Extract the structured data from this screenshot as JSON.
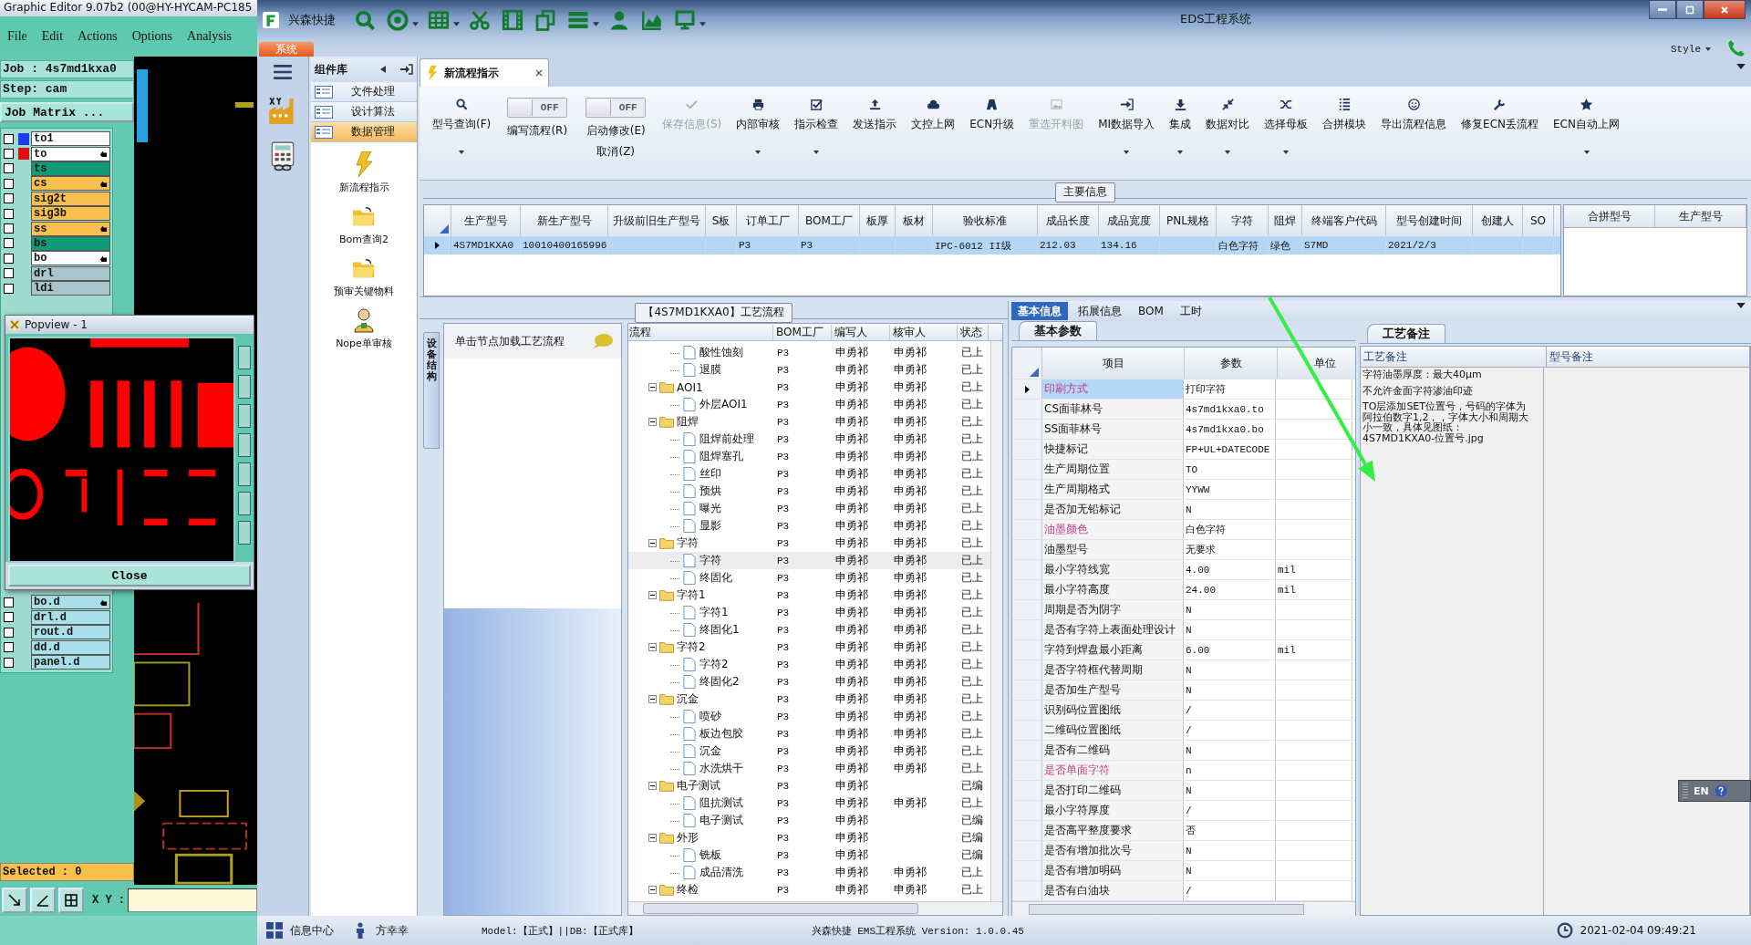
{
  "graphic_editor": {
    "title": "Graphic Editor 9.07b2 (00@HY-HYCAM-PC185",
    "menu": [
      "File",
      "Edit",
      "Actions",
      "Options",
      "Analysis"
    ],
    "job": "Job : 4s7md1kxa0",
    "step": "Step: cam",
    "job_matrix_button": "Job Matrix ...",
    "layers": [
      {
        "name": "to1",
        "color": "#ffffff",
        "swatch": {
          "color": "#1c3cf0"
        },
        "marked": false,
        "checked": false
      },
      {
        "name": "to",
        "color": "#ffffff",
        "swatch": {
          "color": "#e01010"
        },
        "marked": true,
        "checked": false
      },
      {
        "name": "ts",
        "color": "#109a78",
        "marked": false,
        "checked": false
      },
      {
        "name": "cs",
        "color": "#f7c04e",
        "marked": true,
        "checked": false
      },
      {
        "name": "sig2t",
        "color": "#f7c04e",
        "marked": false,
        "checked": false
      },
      {
        "name": "sig3b",
        "color": "#f7c04e",
        "marked": false,
        "checked": false
      },
      {
        "name": "ss",
        "color": "#f7c04e",
        "marked": true,
        "checked": false
      },
      {
        "name": "bs",
        "color": "#109a78",
        "marked": false,
        "checked": false
      },
      {
        "name": "bo",
        "color": "#ffffff",
        "marked": true,
        "checked": false
      },
      {
        "name": "drl",
        "color": "#a8c4cc",
        "marked": false,
        "checked": false
      },
      {
        "name": "ldi",
        "color": "#a8c4cc",
        "marked": false,
        "checked": false
      }
    ],
    "popview": {
      "title": "Popview - 1",
      "close_button": "Close"
    },
    "lower_layers": [
      {
        "name": "bo.d",
        "color": "#a8dfe8",
        "marked": true,
        "checked": false
      },
      {
        "name": "drl.d",
        "color": "#a8dfe8",
        "marked": false,
        "checked": false
      },
      {
        "name": "rout.d",
        "color": "#a8dfe8",
        "marked": false,
        "checked": false
      },
      {
        "name": "dd.d",
        "color": "#a8dfe8",
        "marked": false,
        "checked": false
      },
      {
        "name": "panel.d",
        "color": "#a8dfe8",
        "marked": false,
        "checked": false
      }
    ],
    "selected": "Selected : 0",
    "xy_label": "X Y :"
  },
  "eds": {
    "quick_title": "兴森快捷",
    "title": "EDS工程系统",
    "system_tab": "系统",
    "style_menu": "Style",
    "side_panel": {
      "title": "组件库",
      "groups": [
        {
          "label": "文件处理",
          "selected": false
        },
        {
          "label": "设计算法",
          "selected": false
        },
        {
          "label": "数据管理",
          "selected": true
        }
      ],
      "tools": [
        {
          "label": "新流程指示",
          "kind": "bolt"
        },
        {
          "label": "Bom查询2",
          "kind": "folder"
        },
        {
          "label": "预审关键物料",
          "kind": "folder"
        },
        {
          "label": "Nope单审核",
          "kind": "person"
        }
      ]
    },
    "document_tab": "新流程指示",
    "ribbon": [
      {
        "kind": "button",
        "label": "型号查询(F)",
        "dropdown": true,
        "disabled": false
      },
      {
        "kind": "toggle",
        "toggle_text": "OFF",
        "on": false,
        "label": "编写流程(R)",
        "disabled": false
      },
      {
        "kind": "toggle",
        "toggle_text": "OFF",
        "on": false,
        "label": "启动修改(E)",
        "label_2": "取消(Z)",
        "disabled": false
      },
      {
        "kind": "button",
        "label": "保存信息(S)",
        "dropdown": false,
        "disabled": true
      },
      {
        "kind": "button",
        "label": "内部审核",
        "dropdown": true,
        "disabled": false
      },
      {
        "kind": "button",
        "label": "指示检查",
        "dropdown": true,
        "disabled": false
      },
      {
        "kind": "button",
        "label": "发送指示",
        "dropdown": false,
        "disabled": false
      },
      {
        "kind": "button",
        "label": "文控上网",
        "dropdown": false,
        "disabled": false
      },
      {
        "kind": "button",
        "label": "ECN升级",
        "dropdown": false,
        "disabled": false
      },
      {
        "kind": "button",
        "label": "重选开料图",
        "dropdown": false,
        "disabled": true
      },
      {
        "kind": "button",
        "label": "MI数据导入",
        "dropdown": true,
        "disabled": false
      },
      {
        "kind": "button",
        "label": "集成",
        "dropdown": true,
        "disabled": false
      },
      {
        "kind": "button",
        "label": "数据对比",
        "dropdown": true,
        "disabled": false
      },
      {
        "kind": "button",
        "label": "选择母板",
        "dropdown": true,
        "disabled": false
      },
      {
        "kind": "button",
        "label": "合拼模块",
        "dropdown": false,
        "disabled": false
      },
      {
        "kind": "button",
        "label": "导出流程信息",
        "dropdown": false,
        "disabled": false
      },
      {
        "kind": "button",
        "label": "修复ECN丢流程",
        "dropdown": false,
        "disabled": false
      },
      {
        "kind": "button",
        "label": "ECN自动上网",
        "dropdown": true,
        "disabled": false
      }
    ],
    "main_info": {
      "legend": "主要信息",
      "columns": [
        "生产型号",
        "新生产型号",
        "升级前旧生产型号",
        "S板",
        "订单工厂",
        "BOM工厂",
        "板厚",
        "板材",
        "验收标准",
        "成品长度",
        "成品宽度",
        "PNL规格",
        "字符",
        "阻焊",
        "终端客户代码",
        "型号创建时间",
        "创建人",
        "SO"
      ],
      "rows": [
        {
          "selected": true,
          "cells": [
            "4S7MD1KXA0",
            "10010400165996",
            null,
            null,
            "P3",
            "P3",
            null,
            null,
            "IPC-6012 II级",
            "212.03",
            "134.16",
            null,
            "白色字符",
            "绿色",
            "S7MD",
            "2021/2/3",
            null,
            null
          ]
        }
      ],
      "side_columns": [
        "合拼型号",
        "生产型号"
      ]
    },
    "flow": {
      "title": "【4S7MD1KXA0】工艺流程",
      "side_tab": "设备结构",
      "hint": "单击节点加载工艺流程",
      "columns": [
        "流程",
        "BOM工厂",
        "编写人",
        "核审人",
        "状态"
      ],
      "tree": [
        {
          "children": [
            {
              "kind": "doc",
              "name": "酸性蚀刻",
              "bom": "P3",
              "writer": "申勇祁",
              "reviewer": "申勇祁",
              "status": "已上",
              "selected": false
            },
            {
              "kind": "doc",
              "name": "退膜",
              "bom": "P3",
              "writer": "申勇祁",
              "reviewer": "申勇祁",
              "status": "已上",
              "selected": false
            }
          ]
        },
        {
          "kind": "folder",
          "name": "AOI1",
          "bom": "P3",
          "writer": "申勇祁",
          "reviewer": "申勇祁",
          "status": "已上",
          "selected": false,
          "expanded": true,
          "children": [
            {
              "kind": "doc",
              "name": "外层AOI1",
              "bom": "P3",
              "writer": "申勇祁",
              "reviewer": "申勇祁",
              "status": "已上",
              "selected": false
            }
          ]
        },
        {
          "kind": "folder",
          "name": "阻焊",
          "bom": "P3",
          "writer": "申勇祁",
          "reviewer": "申勇祁",
          "status": "已上",
          "selected": false,
          "expanded": true,
          "children": [
            {
              "kind": "doc",
              "name": "阻焊前处理",
              "bom": "P3",
              "writer": "申勇祁",
              "reviewer": "申勇祁",
              "status": "已上",
              "selected": false
            },
            {
              "kind": "doc",
              "name": "阻焊塞孔",
              "bom": "P3",
              "writer": "申勇祁",
              "reviewer": "申勇祁",
              "status": "已上",
              "selected": false
            },
            {
              "kind": "doc",
              "name": "丝印",
              "bom": "P3",
              "writer": "申勇祁",
              "reviewer": "申勇祁",
              "status": "已上",
              "selected": false
            },
            {
              "kind": "doc",
              "name": "预烘",
              "bom": "P3",
              "writer": "申勇祁",
              "reviewer": "申勇祁",
              "status": "已上",
              "selected": false
            },
            {
              "kind": "doc",
              "name": "曝光",
              "bom": "P3",
              "writer": "申勇祁",
              "reviewer": "申勇祁",
              "status": "已上",
              "selected": false
            },
            {
              "kind": "doc",
              "name": "显影",
              "bom": "P3",
              "writer": "申勇祁",
              "reviewer": "申勇祁",
              "status": "已上",
              "selected": false
            }
          ]
        },
        {
          "kind": "folder",
          "name": "字符",
          "bom": "P3",
          "writer": "申勇祁",
          "reviewer": "申勇祁",
          "status": "已上",
          "selected": false,
          "expanded": true,
          "children": [
            {
              "kind": "doc",
              "name": "字符",
              "bom": "P3",
              "writer": "申勇祁",
              "reviewer": "申勇祁",
              "status": "已上",
              "selected": true
            },
            {
              "kind": "doc",
              "name": "终固化",
              "bom": "P3",
              "writer": "申勇祁",
              "reviewer": "申勇祁",
              "status": "已上",
              "selected": false
            }
          ]
        },
        {
          "kind": "folder",
          "name": "字符1",
          "bom": "P3",
          "writer": "申勇祁",
          "reviewer": "申勇祁",
          "status": "已上",
          "selected": false,
          "expanded": true,
          "children": [
            {
              "kind": "doc",
              "name": "字符1",
              "bom": "P3",
              "writer": "申勇祁",
              "reviewer": "申勇祁",
              "status": "已上",
              "selected": false
            },
            {
              "kind": "doc",
              "name": "终固化1",
              "bom": "P3",
              "writer": "申勇祁",
              "reviewer": "申勇祁",
              "status": "已上",
              "selected": false
            }
          ]
        },
        {
          "kind": "folder",
          "name": "字符2",
          "bom": "P3",
          "writer": "申勇祁",
          "reviewer": "申勇祁",
          "status": "已上",
          "selected": false,
          "expanded": true,
          "children": [
            {
              "kind": "doc",
              "name": "字符2",
              "bom": "P3",
              "writer": "申勇祁",
              "reviewer": "申勇祁",
              "status": "已上",
              "selected": false
            },
            {
              "kind": "doc",
              "name": "终固化2",
              "bom": "P3",
              "writer": "申勇祁",
              "reviewer": "申勇祁",
              "status": "已上",
              "selected": false
            }
          ]
        },
        {
          "kind": "folder",
          "name": "沉金",
          "bom": "P3",
          "writer": "申勇祁",
          "reviewer": "申勇祁",
          "status": "已上",
          "selected": false,
          "expanded": true,
          "children": [
            {
              "kind": "doc",
              "name": "喷砂",
              "bom": "P3",
              "writer": "申勇祁",
              "reviewer": "申勇祁",
              "status": "已上",
              "selected": false
            },
            {
              "kind": "doc",
              "name": "板边包胶",
              "bom": "P3",
              "writer": "申勇祁",
              "reviewer": "申勇祁",
              "status": "已上",
              "selected": false
            },
            {
              "kind": "doc",
              "name": "沉金",
              "bom": "P3",
              "writer": "申勇祁",
              "reviewer": "申勇祁",
              "status": "已上",
              "selected": false
            },
            {
              "kind": "doc",
              "name": "水洗烘干",
              "bom": "P3",
              "writer": "申勇祁",
              "reviewer": "申勇祁",
              "status": "已上",
              "selected": false
            }
          ]
        },
        {
          "kind": "folder",
          "name": "电子测试",
          "bom": "P3",
          "writer": "申勇祁",
          "status": "已编",
          "selected": false,
          "expanded": true,
          "children": [
            {
              "kind": "doc",
              "name": "阻抗测试",
              "bom": "P3",
              "writer": "申勇祁",
              "reviewer": "申勇祁",
              "status": "已上",
              "selected": false
            },
            {
              "kind": "doc",
              "name": "电子测试",
              "bom": "P3",
              "writer": "申勇祁",
              "status": "已编",
              "selected": false
            }
          ]
        },
        {
          "kind": "folder",
          "name": "外形",
          "bom": "P3",
          "writer": "申勇祁",
          "status": "已编",
          "selected": false,
          "expanded": true,
          "children": [
            {
              "kind": "doc",
              "name": "铣板",
              "bom": "P3",
              "writer": "申勇祁",
              "status": "已编",
              "selected": false
            },
            {
              "kind": "doc",
              "name": "成品清洗",
              "bom": "P3",
              "writer": "申勇祁",
              "reviewer": "申勇祁",
              "status": "已上",
              "selected": false
            }
          ]
        },
        {
          "kind": "folder",
          "name": "终检",
          "bom": "P3",
          "writer": "申勇祁",
          "reviewer": "申勇祁",
          "status": "已上",
          "selected": false,
          "expanded": true
        }
      ]
    },
    "detail_tabs": [
      {
        "label": "基本信息",
        "selected": true
      },
      {
        "label": "拓展信息",
        "selected": false
      },
      {
        "label": "BOM",
        "selected": false
      },
      {
        "label": "工时",
        "selected": false
      }
    ],
    "params": {
      "tab": "基本参数",
      "columns": [
        "项目",
        "参数",
        "单位"
      ],
      "rows": [
        {
          "item": "印刷方式",
          "value": "打印字符",
          "flagged": true,
          "selected": true
        },
        {
          "item": "CS面菲林号",
          "value": "4s7md1kxa0.to",
          "flagged": false,
          "selected": false
        },
        {
          "item": "SS面菲林号",
          "value": "4s7md1kxa0.bo",
          "flagged": false,
          "selected": false
        },
        {
          "item": "快捷标记",
          "value": "FP+UL+DATECODE",
          "flagged": false,
          "selected": false
        },
        {
          "item": "生产周期位置",
          "value": "TO",
          "flagged": false,
          "selected": false
        },
        {
          "item": "生产周期格式",
          "value": "YYWW",
          "flagged": false,
          "selected": false
        },
        {
          "item": "是否加无铅标记",
          "value": "N",
          "flagged": false,
          "selected": false
        },
        {
          "item": "油墨颜色",
          "value": "白色字符",
          "flagged": true,
          "selected": false
        },
        {
          "item": "油墨型号",
          "value": "无要求",
          "flagged": false,
          "selected": false
        },
        {
          "item": "最小字符线宽",
          "value": "4.00",
          "unit": "mil",
          "flagged": false,
          "selected": false
        },
        {
          "item": "最小字符高度",
          "value": "24.00",
          "unit": "mil",
          "flagged": false,
          "selected": false
        },
        {
          "item": "周期是否为阴字",
          "value": "N",
          "flagged": false,
          "selected": false
        },
        {
          "item": "是否有字符上表面处理设计",
          "value": "N",
          "flagged": false,
          "selected": false
        },
        {
          "item": "字符到焊盘最小距离",
          "value": "6.00",
          "unit": "mil",
          "flagged": false,
          "selected": false
        },
        {
          "item": "是否字符框代替周期",
          "value": "N",
          "flagged": false,
          "selected": false
        },
        {
          "item": "是否加生产型号",
          "value": "N",
          "flagged": false,
          "selected": false
        },
        {
          "item": "识别码位置图纸",
          "value": "/",
          "flagged": false,
          "selected": false
        },
        {
          "item": "二维码位置图纸",
          "value": "/",
          "flagged": false,
          "selected": false
        },
        {
          "item": "是否有二维码",
          "value": "N",
          "flagged": false,
          "selected": false
        },
        {
          "item": "是否单面字符",
          "value": "n",
          "flagged": true,
          "selected": false
        },
        {
          "item": "是否打印二维码",
          "value": "N",
          "flagged": false,
          "selected": false
        },
        {
          "item": "最小字符厚度",
          "value": "/",
          "flagged": false,
          "selected": false
        },
        {
          "item": "是否高平整度要求",
          "value": "否",
          "flagged": false,
          "selected": false
        },
        {
          "item": "是否有增加批次号",
          "value": "N",
          "flagged": false,
          "selected": false
        },
        {
          "item": "是否有增加明码",
          "value": "N",
          "flagged": false,
          "selected": false
        },
        {
          "item": "是否有白油块",
          "value": "/",
          "flagged": false,
          "selected": false
        }
      ]
    },
    "notes": {
      "tab": "工艺备注",
      "columns": [
        "工艺备注",
        "型号备注"
      ],
      "process_notes": [
        "字符油墨厚度：最大40μm",
        "不允许金面字符渗油印迹",
        "TO层添加SET位置号，号码的字体为阿拉伯数字1,2，，字体大小和周期大小一致，具体见图纸：4S7MD1KXA0-位置号.jpg"
      ]
    },
    "ime": "EN",
    "status_bar": {
      "info_center": "信息中心",
      "user": "方幸幸",
      "model": "Model:【正式】||DB:【正式库】",
      "version": "兴森快捷 EMS工程系统 Version: 1.0.0.45",
      "datetime": "2021-02-04 09:49:21"
    }
  }
}
